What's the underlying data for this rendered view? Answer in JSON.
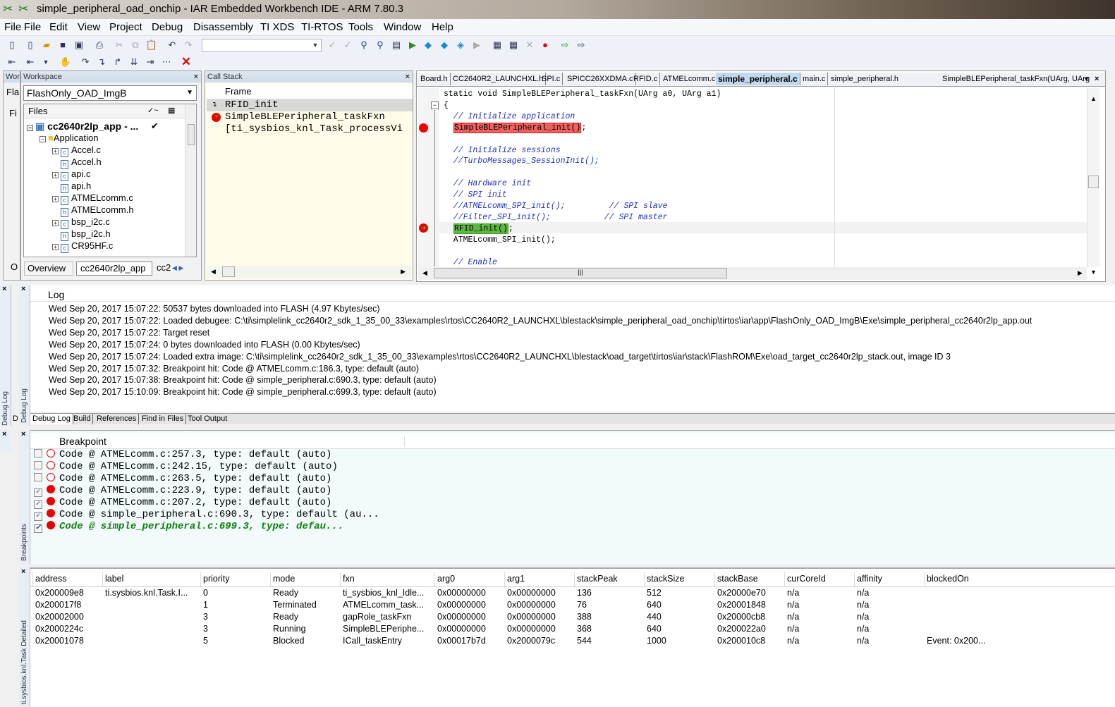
{
  "window": {
    "title": "simple_peripheral_oad_onchip - IAR Embedded Workbench IDE - ARM 7.80.3"
  },
  "menu": {
    "ghost": "File",
    "items": [
      "File",
      "Edit",
      "View",
      "Project",
      "Debug",
      "Disassembly",
      "TI XDS",
      "TI-RTOS",
      "Tools",
      "Window",
      "Help"
    ]
  },
  "toolbar": {
    "config_combo": ""
  },
  "workspace": {
    "title": "Workspace",
    "ghost_title": "Worl",
    "ghost_combo": "Fla",
    "ghost_files": "Fi",
    "ghost_tab": "O",
    "config": "FlashOnly_OAD_ImgB",
    "files_header": "Files",
    "project": "cc2640r2lp_app - ...",
    "group": "Application",
    "files": [
      {
        "name": "Accel.c",
        "type": "c",
        "expandable": true
      },
      {
        "name": "Accel.h",
        "type": "h",
        "expandable": false
      },
      {
        "name": "api.c",
        "type": "c",
        "expandable": true
      },
      {
        "name": "api.h",
        "type": "h",
        "expandable": false
      },
      {
        "name": "ATMELcomm.c",
        "type": "c",
        "expandable": true
      },
      {
        "name": "ATMELcomm.h",
        "type": "h",
        "expandable": false
      },
      {
        "name": "bsp_i2c.c",
        "type": "c",
        "expandable": true
      },
      {
        "name": "bsp_i2c.h",
        "type": "h",
        "expandable": false
      },
      {
        "name": "CR95HF.c",
        "type": "c",
        "expandable": true
      }
    ],
    "tabs": [
      "Overview",
      "cc2640r2lp_app",
      "cc2"
    ]
  },
  "callstack": {
    "title": "Call Stack",
    "header": "Frame",
    "frames": [
      "RFID_init",
      "SimpleBLEPeripheral_taskFxn",
      "[ti_sysbios_knl_Task_processVi"
    ]
  },
  "editor": {
    "tabs": [
      "Board.h",
      "CC2640R2_LAUNCHXL.h",
      "SPI.c",
      "SPICC26XXDMA.c",
      "RFID.c",
      "ATMELcomm.c",
      "simple_peripheral.c",
      "main.c",
      "simple_peripheral.h"
    ],
    "active_tab": "simple_peripheral.c",
    "function_combo": "SimpleBLEPeripheral_taskFxn(UArg, UArg",
    "lines": [
      {
        "text": "static void SimpleBLEPeripheral_taskFxn(UArg a0, UArg a1)",
        "kind": "code"
      },
      {
        "text": "{",
        "kind": "code"
      },
      {
        "text": "  // Initialize application",
        "kind": "comment"
      },
      {
        "text": "SimpleBLEPeripheral_init()",
        "suffix": ";",
        "kind": "breakpoint"
      },
      {
        "text": "",
        "kind": "code"
      },
      {
        "text": "  // Initialize sessions",
        "kind": "comment"
      },
      {
        "text": "  //TurboMessages_SessionInit();",
        "kind": "comment"
      },
      {
        "text": "",
        "kind": "code"
      },
      {
        "text": "  // Hardware init",
        "kind": "comment"
      },
      {
        "text": "  // SPI init",
        "kind": "comment"
      },
      {
        "text": "  //ATMELcomm_SPI_init();         // SPI slave",
        "kind": "comment"
      },
      {
        "text": "  //Filter_SPI_init();           // SPI master",
        "kind": "comment"
      },
      {
        "text": "RFID_init()",
        "suffix": ";",
        "kind": "current"
      },
      {
        "text": "  ATMELcomm_SPI_init();",
        "kind": "code"
      },
      {
        "text": "",
        "kind": "code"
      },
      {
        "text": "  // Enable",
        "kind": "comment"
      }
    ]
  },
  "log": {
    "header": "Log",
    "lines": [
      "Wed Sep 20, 2017 15:07:22: 50537 bytes downloaded into FLASH (4.97 Kbytes/sec)",
      "Wed Sep 20, 2017 15:07:22: Loaded debugee: C:\\ti\\simplelink_cc2640r2_sdk_1_35_00_33\\examples\\rtos\\CC2640R2_LAUNCHXL\\blestack\\simple_peripheral_oad_onchip\\tirtos\\iar\\app\\FlashOnly_OAD_ImgB\\Exe\\simple_peripheral_cc2640r2lp_app.out",
      "Wed Sep 20, 2017 15:07:22: Target reset",
      "Wed Sep 20, 2017 15:07:24: 0 bytes downloaded into FLASH (0.00 Kbytes/sec)",
      "Wed Sep 20, 2017 15:07:24: Loaded extra image: C:\\ti\\simplelink_cc2640r2_sdk_1_35_00_33\\examples\\rtos\\CC2640R2_LAUNCHXL\\blestack\\oad_target\\tirtos\\iar\\stack\\FlashROM\\Exe\\oad_target_cc2640r2lp_stack.out, image ID 3",
      "Wed Sep 20, 2017 15:07:32: Breakpoint hit: Code @ ATMELcomm.c:186.3, type: default (auto)",
      "Wed Sep 20, 2017 15:07:38: Breakpoint hit: Code @ simple_peripheral.c:690.3, type: default (auto)",
      "Wed Sep 20, 2017 15:10:09: Breakpoint hit: Code @ simple_peripheral.c:699.3, type: default (auto)"
    ],
    "tabs": [
      "Debug Log",
      "Build",
      "References",
      "Find in Files",
      "Tool Output"
    ],
    "side_label": "Debug Log",
    "ghost_side": "Debug Log",
    "ghost_tab": "D"
  },
  "breakpoints": {
    "header": "Breakpoint",
    "side_label": "Breakpoints",
    "items": [
      {
        "text": "Code @ ATMELcomm.c:257.3, type: default (auto)",
        "enabled": false,
        "current": false
      },
      {
        "text": "Code @ ATMELcomm.c:242.15, type: default (auto)",
        "enabled": false,
        "current": false
      },
      {
        "text": "Code @ ATMELcomm.c:263.5, type: default (auto)",
        "enabled": false,
        "current": false
      },
      {
        "text": "Code @ ATMELcomm.c:223.9, type: default (auto)",
        "enabled": true,
        "current": false
      },
      {
        "text": "Code @ ATMELcomm.c:207.2, type: default (auto)",
        "enabled": true,
        "current": false
      },
      {
        "text": "Code @ simple_peripheral.c:690.3, type: default (au...",
        "enabled": true,
        "current": false
      },
      {
        "text": "Code @ simple_peripheral.c:699.3, type: defau...",
        "enabled": true,
        "current": true
      }
    ]
  },
  "tasks": {
    "side_label": "ti.sysbios.knl.Task Detailed",
    "columns": [
      "address",
      "label",
      "priority",
      "mode",
      "fxn",
      "arg0",
      "arg1",
      "stackPeak",
      "stackSize",
      "stackBase",
      "curCoreId",
      "affinity",
      "blockedOn"
    ],
    "rows": [
      [
        "0x200009e8",
        "ti.sysbios.knl.Task.I...",
        "0",
        "Ready",
        "ti_sysbios_knl_Idle...",
        "0x00000000",
        "0x00000000",
        "136",
        "512",
        "0x20000e70",
        "n/a",
        "n/a",
        ""
      ],
      [
        "0x200017f8",
        "",
        "1",
        "Terminated",
        "ATMELcomm_task...",
        "0x00000000",
        "0x00000000",
        "76",
        "640",
        "0x20001848",
        "n/a",
        "n/a",
        ""
      ],
      [
        "0x20002000",
        "",
        "3",
        "Ready",
        "gapRole_taskFxn",
        "0x00000000",
        "0x00000000",
        "388",
        "440",
        "0x20000cb8",
        "n/a",
        "n/a",
        ""
      ],
      [
        "0x2000224c",
        "",
        "3",
        "Running",
        "SimpleBLEPeriphe...",
        "0x00000000",
        "0x00000000",
        "368",
        "640",
        "0x200022a0",
        "n/a",
        "n/a",
        ""
      ],
      [
        "0x20001078",
        "",
        "5",
        "Blocked",
        "ICall_taskEntry",
        "0x00017b7d",
        "0x2000079c",
        "544",
        "1000",
        "0x200010c8",
        "n/a",
        "n/a",
        "Event: 0x200..."
      ]
    ]
  }
}
